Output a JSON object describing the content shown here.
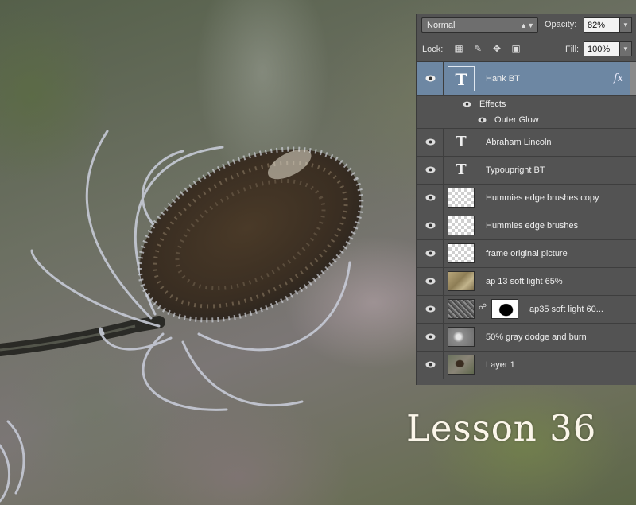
{
  "options": {
    "blend_mode": "Normal",
    "opacity_label": "Opacity:",
    "opacity_value": "82%",
    "lock_label": "Lock:",
    "fill_label": "Fill:",
    "fill_value": "100%"
  },
  "layers": [
    {
      "name": "Hank BT",
      "kind": "text",
      "selected": true,
      "fx": "fx"
    },
    {
      "name": "Abraham Lincoln",
      "kind": "text"
    },
    {
      "name": "Typoupright BT",
      "kind": "text"
    },
    {
      "name": "Hummies edge brushes copy",
      "kind": "transparent"
    },
    {
      "name": "Hummies edge brushes",
      "kind": "transparent"
    },
    {
      "name": "frame original picture",
      "kind": "transparent"
    },
    {
      "name": "ap 13 soft light 65%",
      "kind": "texture"
    },
    {
      "name": "ap35 soft light 60...",
      "kind": "masked"
    },
    {
      "name": "50% gray dodge and burn",
      "kind": "gray"
    },
    {
      "name": "Layer 1",
      "kind": "photo"
    }
  ],
  "effects": {
    "label": "Effects",
    "items": [
      "Outer Glow"
    ]
  },
  "caption": "Lesson 36",
  "colors": {
    "panel": "#535353",
    "selected_row": "#6d87a3",
    "caption": "#fbf6ea"
  }
}
